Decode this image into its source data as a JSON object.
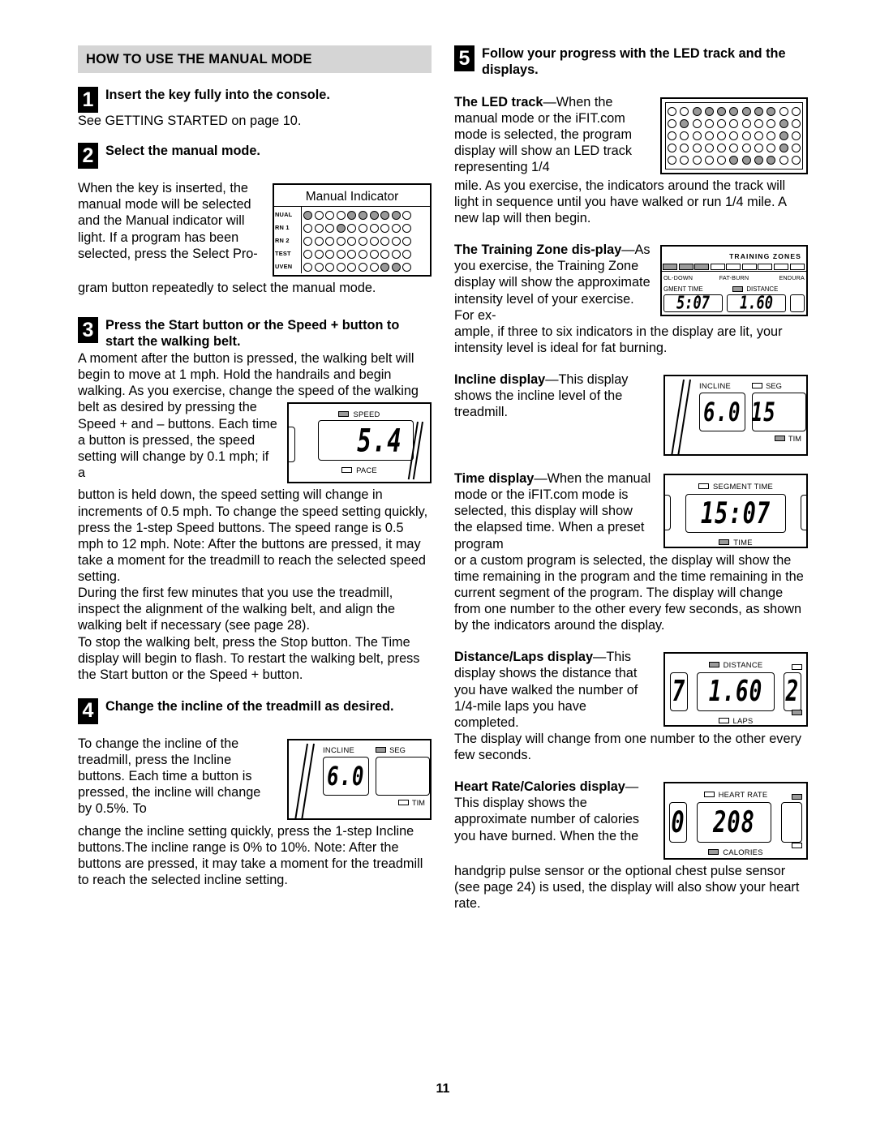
{
  "page_number": "11",
  "left_column": {
    "section_header": "HOW TO USE THE MANUAL MODE",
    "step1": {
      "number": "1",
      "title": "Insert the key fully into the console.",
      "body": "See GETTING STARTED on page 10."
    },
    "step2": {
      "number": "2",
      "title": "Select the manual mode.",
      "body_wrapped": "When the key is inserted, the manual mode will be selected and the Manual indicator will light. If a program has been selected, press the Select Pro-",
      "body_full": "gram button repeatedly to select the manual mode."
    },
    "step3": {
      "number": "3",
      "title": "Press the Start button or the Speed + button to start the walking belt.",
      "para1_lead": "A moment after the button is pressed, the walking belt will begin to move at 1 mph. Hold the handrails and begin walking. As you exercise, change the speed of the walking",
      "para1_wrapped": "belt as desired by pressing the Speed + and – buttons. Each time a button is pressed, the speed setting will change by 0.1 mph; if a",
      "para1_rest": "button is held down, the speed setting will change in increments of 0.5 mph. To change the speed setting quickly, press the 1-step Speed buttons. The speed range is 0.5 mph to 12 mph. Note: After the buttons are pressed, it may take a moment for the treadmill to reach the selected speed setting.",
      "para2": "During the first few minutes that you use the treadmill, inspect the alignment of the walking belt, and align the walking belt if necessary (see page 28).",
      "para3": "To stop the walking belt, press the Stop button. The Time display will begin to flash. To restart the walking belt, press the Start button or the Speed + button."
    },
    "step4": {
      "number": "4",
      "title": "Change the incline of the treadmill as desired.",
      "para_wrapped": "To change the incline of the treadmill, press the Incline buttons. Each time a button is pressed, the incline will change by 0.5%. To",
      "para_rest": "change the incline setting quickly, press the 1-step Incline buttons.The incline range is 0% to 10%. Note: After the buttons are pressed, it may take a moment for the treadmill to reach the selected incline setting."
    }
  },
  "right_column": {
    "step5": {
      "number": "5",
      "title": "Follow your progress with the LED track and the displays."
    },
    "led_track": {
      "heading": "The LED track",
      "dash": "—",
      "lead": "When the manual mode or the iFIT.com mode is selected, the program display will show an LED track representing 1/4",
      "rest": "mile. As you exercise, the indicators around the track will light in sequence until you have walked or run 1/4 mile. A new lap will then begin."
    },
    "training_zone": {
      "heading": "The Training Zone dis-play",
      "dash": "—",
      "lead": "As you exercise, the Training Zone display will show the approximate intensity level of your exercise. For ex-",
      "rest": "ample, if three to six indicators in the display are lit, your intensity level is ideal for fat burning."
    },
    "incline_display": {
      "heading": "Incline display",
      "dash": "—",
      "lead": "This display shows the incline level of the treadmill."
    },
    "time_display": {
      "heading": "Time display",
      "dash": "—",
      "lead": "When the manual mode or the iFIT.com mode is selected, this display will show the elapsed time. When a preset program",
      "rest": "or a custom program is selected, the display will show the time remaining in the program and the time remaining in the current segment of the program. The display will change from one number to the other every few seconds, as shown by the indicators around the display."
    },
    "distance_display": {
      "heading": "Distance/Laps display",
      "dash": "—",
      "lead": "This display shows the distance that you have walked the number of 1/4-mile laps you have completed.",
      "rest": "The display will change from one number to the other every few seconds."
    },
    "heart_rate_display": {
      "heading": "Heart Rate/Calories display",
      "dash": "—",
      "lead": "This display shows the approximate number of calories you have burned. When the the",
      "rest": "handgrip pulse sensor or the optional chest pulse sensor (see page 24) is used, the display will also show your heart rate."
    }
  },
  "figures": {
    "manual_indicator": {
      "caption": "Manual Indicator",
      "row_labels": [
        "NUAL",
        "RN 1",
        "RN 2",
        "TEST",
        "UVEN"
      ],
      "rows": [
        [
          1,
          0,
          0,
          0,
          1,
          1,
          1,
          1,
          1,
          0
        ],
        [
          0,
          0,
          0,
          1,
          0,
          0,
          0,
          0,
          0,
          0
        ],
        [
          0,
          0,
          0,
          0,
          0,
          0,
          0,
          0,
          0,
          0
        ],
        [
          0,
          0,
          0,
          0,
          0,
          0,
          0,
          0,
          0,
          0
        ],
        [
          0,
          0,
          0,
          0,
          0,
          0,
          0,
          1,
          1,
          0
        ]
      ]
    },
    "led_track": {
      "rows": [
        [
          0,
          0,
          1,
          1,
          1,
          1,
          1,
          1,
          1,
          0,
          0
        ],
        [
          0,
          1,
          0,
          0,
          0,
          0,
          0,
          0,
          0,
          1,
          0
        ],
        [
          0,
          0,
          0,
          0,
          0,
          0,
          0,
          0,
          0,
          1,
          0
        ],
        [
          0,
          0,
          0,
          0,
          0,
          0,
          0,
          0,
          0,
          1,
          0
        ],
        [
          0,
          0,
          0,
          0,
          0,
          1,
          1,
          1,
          1,
          0,
          0
        ]
      ]
    },
    "training_zones": {
      "title": "TRAINING ZONES",
      "segments": [
        1,
        1,
        1,
        0,
        0,
        0,
        0,
        0,
        0
      ],
      "labels": [
        "OL-DOWN",
        "FAT-BURN",
        "ENDURA"
      ],
      "sub_left": "GMENT TIME",
      "sub_right": "DISTANCE",
      "digit_left": "5:07",
      "digit_right": "1.60"
    },
    "speed": {
      "top_label": "SPEED",
      "top_on": true,
      "value": "5.4",
      "bottom_label": "PACE",
      "bottom_on": false
    },
    "incline_right": {
      "label": "INCLINE",
      "value": "6.0",
      "side_top_label": "SEG",
      "side_top_on": false,
      "side_bottom_label": "TIM",
      "side_bottom_on": true,
      "side_value": "15"
    },
    "incline_left": {
      "label": "INCLINE",
      "value": "6.0",
      "side_top_label": "SEG",
      "side_top_on": true,
      "side_bottom_label": "TIM",
      "side_bottom_on": false,
      "side_value": ""
    },
    "time": {
      "top_label": "SEGMENT TIME",
      "top_on": false,
      "value": "15:07",
      "bottom_label": "TIME",
      "bottom_on": true
    },
    "distance": {
      "top_label": "DISTANCE",
      "top_on": true,
      "value": "1.60",
      "bottom_label": "LAPS",
      "bottom_on": false,
      "left_digit": "7",
      "right_digit": "2"
    },
    "heart_rate": {
      "top_label": "HEART RATE",
      "top_on": false,
      "value": "208",
      "bottom_label": "CALORIES",
      "bottom_on": true,
      "left_digit": "0"
    }
  }
}
